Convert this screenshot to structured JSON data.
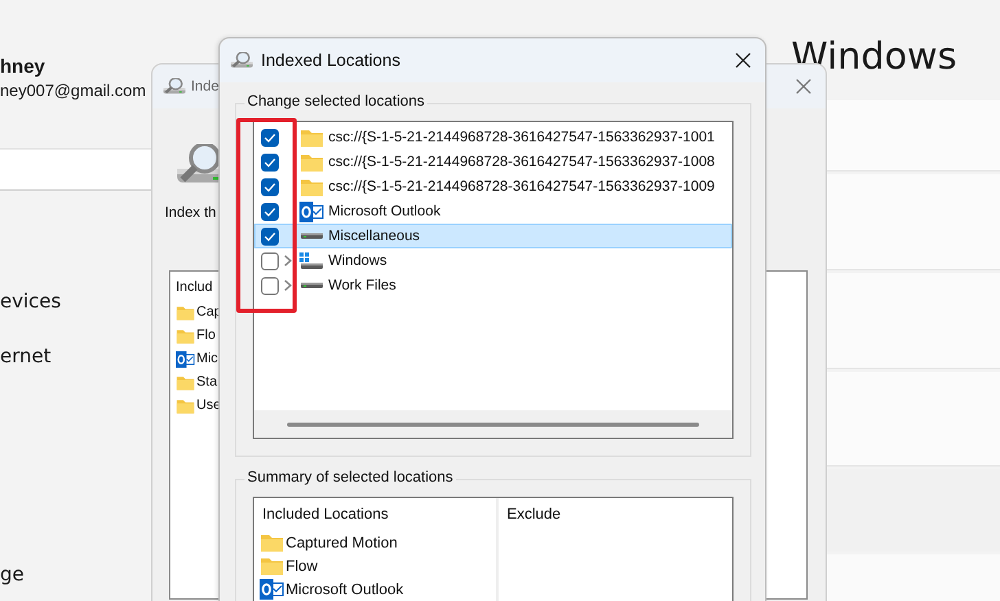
{
  "background_window": {
    "user_name": "hney",
    "user_email": "ney007@gmail.com",
    "page_title": "Windows",
    "nav_items": [
      "evices",
      "ernet",
      "ge"
    ]
  },
  "indexing_options": {
    "title": "Inde",
    "intro": "Index th",
    "list_header": "Includ",
    "items": [
      {
        "kind": "folder",
        "label": "Cap"
      },
      {
        "kind": "folder",
        "label": "Flo"
      },
      {
        "kind": "outlook",
        "label": "Mic"
      },
      {
        "kind": "folder",
        "label": "Sta"
      },
      {
        "kind": "folder",
        "label": "Use"
      }
    ]
  },
  "dialog": {
    "title": "Indexed Locations",
    "change_group": {
      "label": "Change selected locations",
      "items": [
        {
          "kind": "folder",
          "label": "csc://{S-1-5-21-2144968728-3616427547-1563362937-1001",
          "checked": true,
          "expandable": false,
          "selected": false
        },
        {
          "kind": "folder",
          "label": "csc://{S-1-5-21-2144968728-3616427547-1563362937-1008",
          "checked": true,
          "expandable": false,
          "selected": false
        },
        {
          "kind": "folder",
          "label": "csc://{S-1-5-21-2144968728-3616427547-1563362937-1009",
          "checked": true,
          "expandable": false,
          "selected": false
        },
        {
          "kind": "outlook",
          "label": "Microsoft Outlook",
          "checked": true,
          "expandable": false,
          "selected": false
        },
        {
          "kind": "drive",
          "label": "Miscellaneous",
          "checked": true,
          "expandable": false,
          "selected": true
        },
        {
          "kind": "windows-drive",
          "label": "Windows",
          "checked": false,
          "expandable": true,
          "selected": false
        },
        {
          "kind": "drive",
          "label": "Work Files",
          "checked": false,
          "expandable": true,
          "selected": false
        }
      ]
    },
    "summary_group": {
      "label": "Summary of selected locations",
      "columns": [
        "Included Locations",
        "Exclude"
      ],
      "items": [
        {
          "kind": "folder",
          "label": "Captured Motion"
        },
        {
          "kind": "folder",
          "label": "Flow"
        },
        {
          "kind": "outlook",
          "label": "Microsoft Outlook"
        }
      ]
    }
  }
}
